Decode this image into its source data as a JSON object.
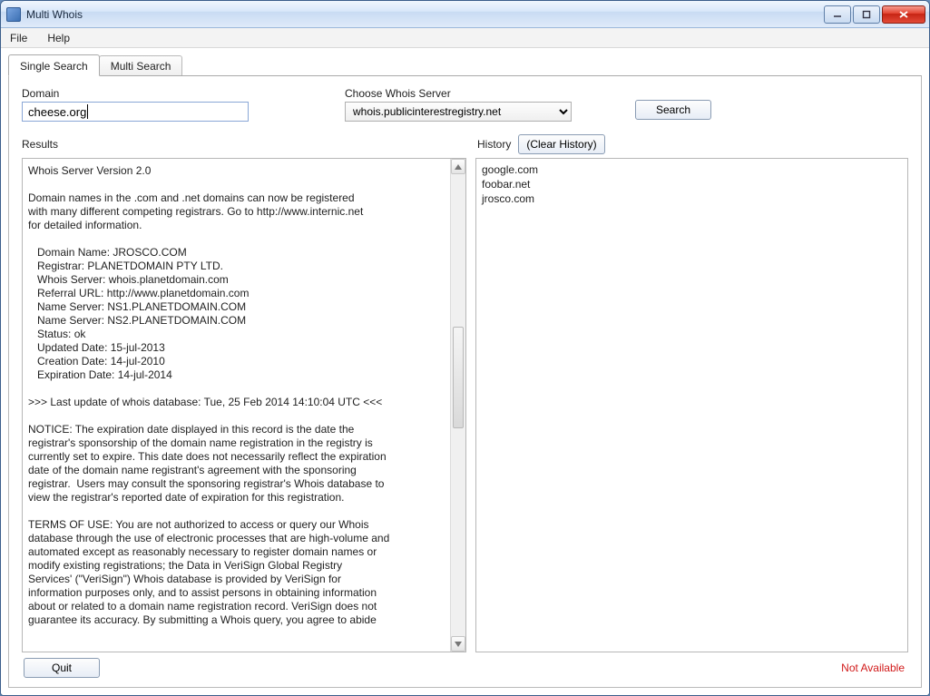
{
  "window": {
    "title": "Multi Whois"
  },
  "menubar": {
    "file": "File",
    "help": "Help"
  },
  "tabs": {
    "single": "Single Search",
    "multi": "Multi Search"
  },
  "form": {
    "domain_label": "Domain",
    "domain_value": "cheese.org",
    "server_label": "Choose Whois Server",
    "server_selected": "whois.publicinterestregistry.net",
    "search_label": "Search"
  },
  "labels": {
    "results": "Results",
    "history": "History",
    "clear_history": "(Clear History)"
  },
  "history": {
    "items": [
      "google.com",
      "foobar.net",
      "jrosco.com"
    ]
  },
  "results": {
    "text": "Whois Server Version 2.0\n\nDomain names in the .com and .net domains can now be registered\nwith many different competing registrars. Go to http://www.internic.net\nfor detailed information.\n\n   Domain Name: JROSCO.COM\n   Registrar: PLANETDOMAIN PTY LTD.\n   Whois Server: whois.planetdomain.com\n   Referral URL: http://www.planetdomain.com\n   Name Server: NS1.PLANETDOMAIN.COM\n   Name Server: NS2.PLANETDOMAIN.COM\n   Status: ok\n   Updated Date: 15-jul-2013\n   Creation Date: 14-jul-2010\n   Expiration Date: 14-jul-2014\n\n>>> Last update of whois database: Tue, 25 Feb 2014 14:10:04 UTC <<<\n\nNOTICE: The expiration date displayed in this record is the date the\nregistrar's sponsorship of the domain name registration in the registry is\ncurrently set to expire. This date does not necessarily reflect the expiration\ndate of the domain name registrant's agreement with the sponsoring\nregistrar.  Users may consult the sponsoring registrar's Whois database to\nview the registrar's reported date of expiration for this registration.\n\nTERMS OF USE: You are not authorized to access or query our Whois\ndatabase through the use of electronic processes that are high-volume and\nautomated except as reasonably necessary to register domain names or\nmodify existing registrations; the Data in VeriSign Global Registry\nServices' (\"VeriSign\") Whois database is provided by VeriSign for\ninformation purposes only, and to assist persons in obtaining information\nabout or related to a domain name registration record. VeriSign does not\nguarantee its accuracy. By submitting a Whois query, you agree to abide"
  },
  "footer": {
    "quit": "Quit",
    "status": "Not Available"
  }
}
